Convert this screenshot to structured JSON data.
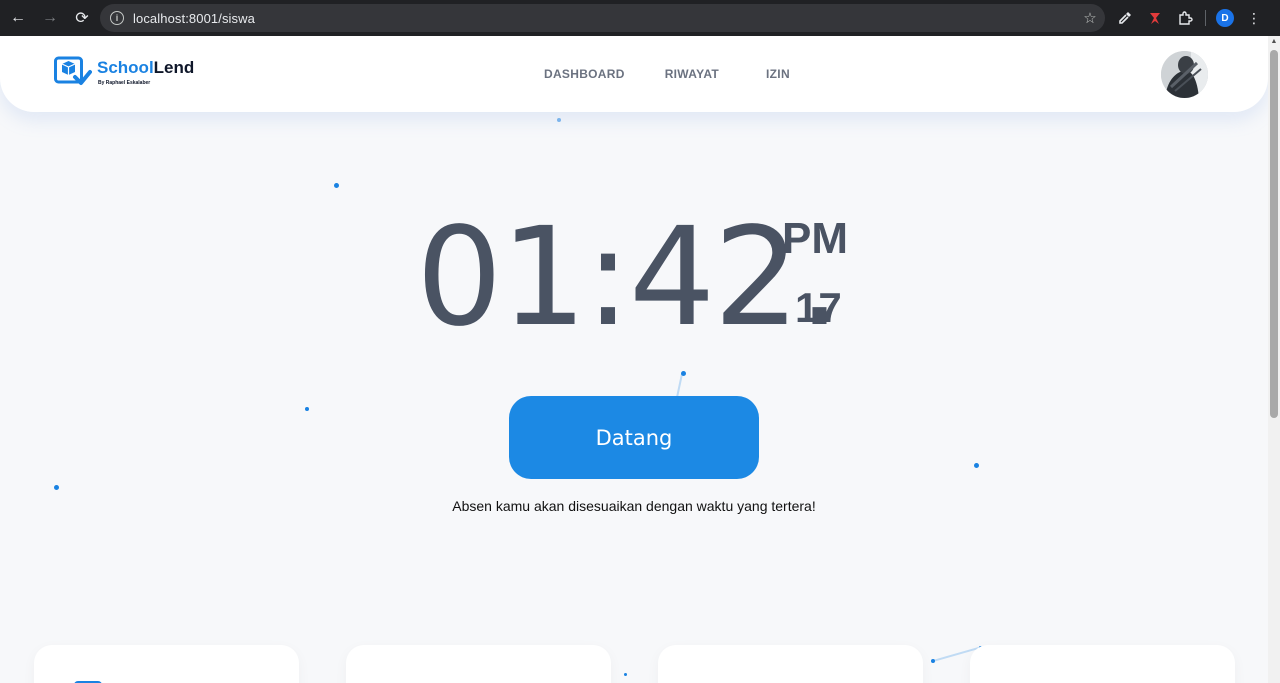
{
  "browser": {
    "url": "localhost:8001/siswa",
    "profile_initial": "D"
  },
  "navbar": {
    "brand_primary": "School",
    "brand_secondary": "Lend",
    "brand_by": "By Raphael Eskalaber",
    "menu": [
      "DASHBOARD",
      "RIWAYAT",
      "IZIN"
    ]
  },
  "clock": {
    "time": "01:42.",
    "period": "PM",
    "seconds": "17"
  },
  "attendance": {
    "button_label": "Datang",
    "notice": "Absen kamu akan disesuaikan dengan waktu yang tertera!"
  },
  "colors": {
    "accent": "#1c89e4",
    "text_dark": "#4a5363",
    "background": "#f7f8fa"
  }
}
